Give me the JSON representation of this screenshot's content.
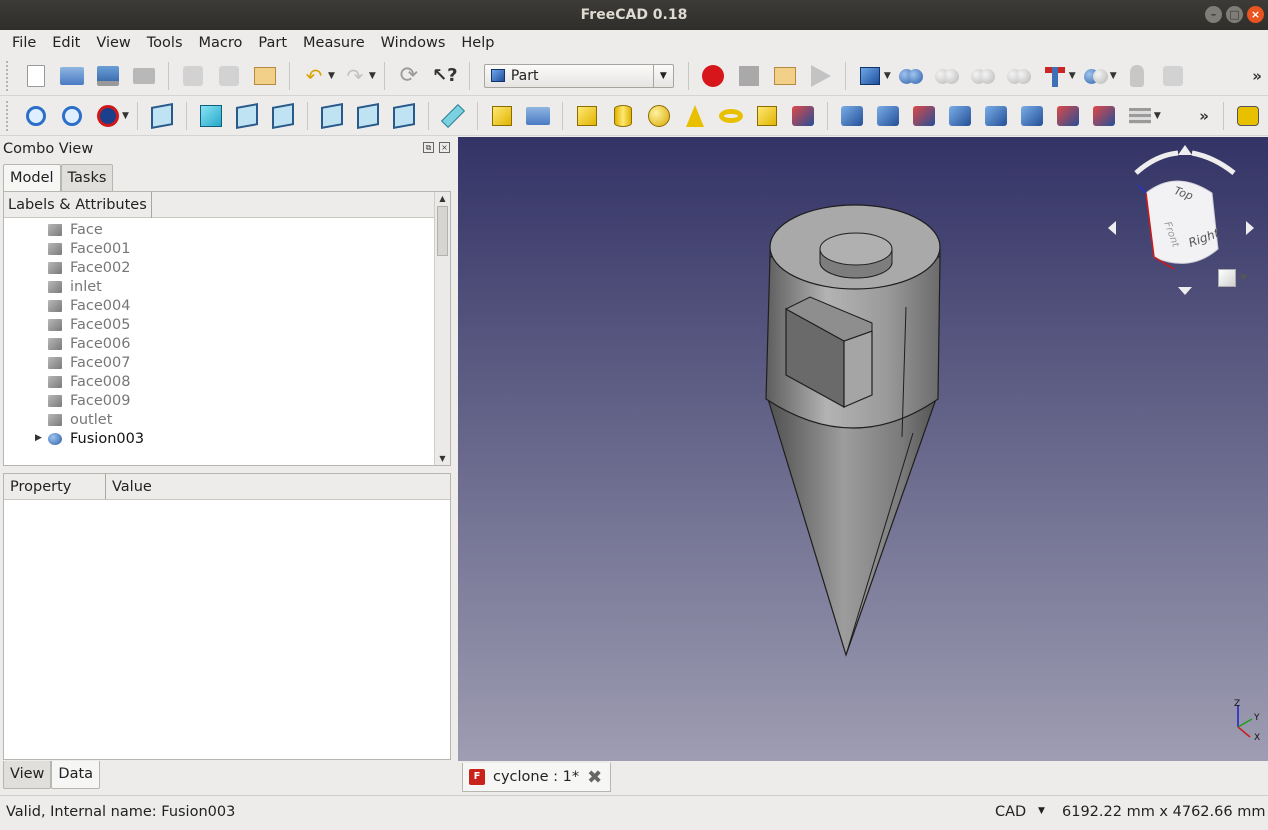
{
  "window": {
    "title": "FreeCAD 0.18"
  },
  "menu": [
    "File",
    "Edit",
    "View",
    "Tools",
    "Macro",
    "Part",
    "Measure",
    "Windows",
    "Help"
  ],
  "toolbar1": {
    "workbench": "Part",
    "more": "»"
  },
  "toolbar2": {
    "more": "»"
  },
  "combo": {
    "title": "Combo View",
    "tabs": [
      "Model",
      "Tasks"
    ],
    "tree_header": "Labels & Attributes",
    "tree_items": [
      "Face",
      "Face001",
      "Face002",
      "inlet",
      "Face004",
      "Face005",
      "Face006",
      "Face007",
      "Face008",
      "Face009",
      "outlet",
      "Fusion003"
    ],
    "property_headers": [
      "Property",
      "Value"
    ],
    "bottom_tabs": [
      "View",
      "Data"
    ]
  },
  "viewport": {
    "navcube_faces": [
      "Top",
      "Right",
      "Front"
    ],
    "axes": [
      "Z",
      "Y",
      "X"
    ],
    "colors": {
      "background_top": "#333366",
      "background_bottom": "#9e9db2",
      "model": "#8c8c8c"
    }
  },
  "document_tab": {
    "label": "cyclone : 1*"
  },
  "status": {
    "message": "Valid, Internal name: Fusion003",
    "nav_style": "CAD",
    "dimensions": "6192.22 mm x 4762.66 mm"
  }
}
